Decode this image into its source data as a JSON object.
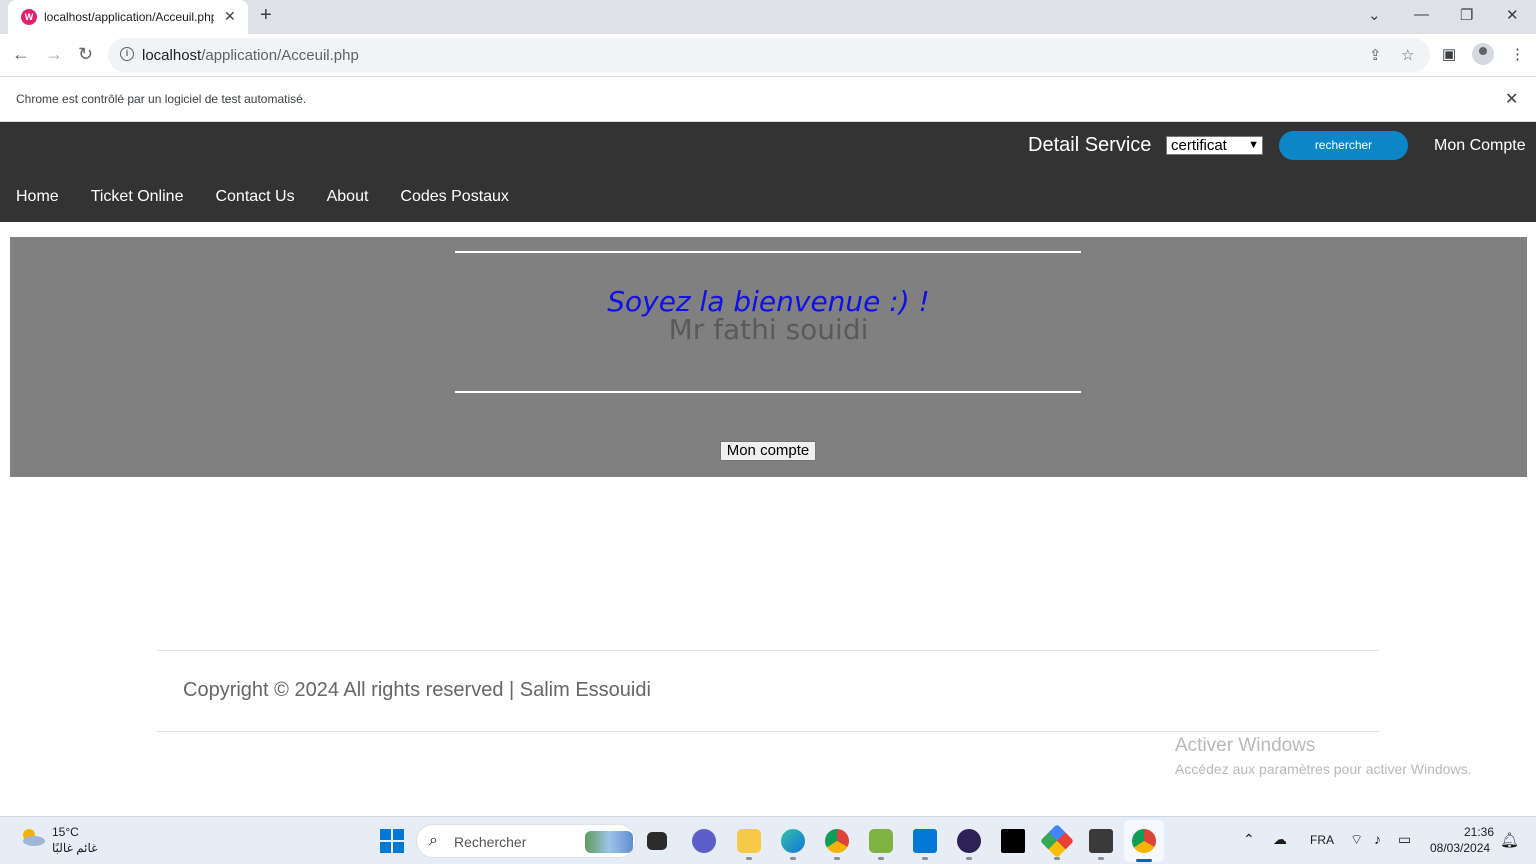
{
  "browser": {
    "tab_title": "localhost/application/Acceuil.php",
    "url_host": "localhost",
    "url_path": "/application/Acceuil.php",
    "infobar_text": "Chrome est contrôlé par un logiciel de test automatisé."
  },
  "header": {
    "detail_label": "Detail Service",
    "service_selected": "certificat",
    "search_label": "rechercher",
    "account_label": "Mon Compte",
    "nav": [
      "Home",
      "Ticket Online",
      "Contact Us",
      "About",
      "Codes Postaux"
    ]
  },
  "welcome": {
    "greeting": "Soyez la bienvenue :) !",
    "user_name": "Mr fathi souidi",
    "account_button": "Mon compte"
  },
  "footer": {
    "copyright": "Copyright © 2024 All rights reserved | Salim Essouidi"
  },
  "watermark": {
    "title": "Activer Windows",
    "subtitle": "Accédez aux paramètres pour activer Windows."
  },
  "taskbar": {
    "weather_temp": "15°C",
    "weather_desc": "غائم غالبًا",
    "search_placeholder": "Rechercher",
    "language": "FRA",
    "time": "21:36",
    "date": "08/03/2024",
    "accent": "#0067c0"
  },
  "colors": {
    "header_bg": "#333333",
    "search_button": "#0b87c8",
    "welcome_bg": "#808080",
    "greeting": "#1010e8"
  }
}
